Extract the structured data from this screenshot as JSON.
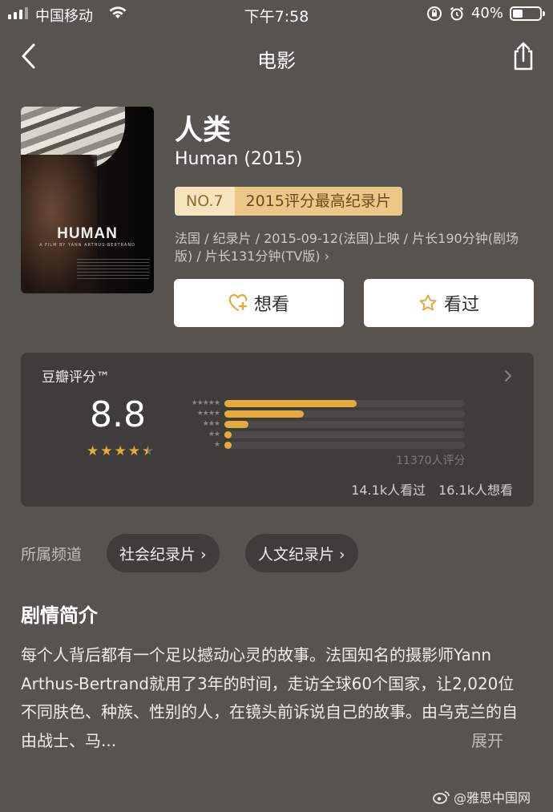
{
  "status_bar": {
    "carrier": "中国移动",
    "time": "下午7:58",
    "battery_percent": "40%",
    "battery_level": 0.4
  },
  "nav": {
    "title": "电影",
    "back_icon": "chevron-left-icon",
    "share_icon": "share-icon"
  },
  "movie": {
    "poster_title": "HUMAN",
    "poster_subtitle": "A FILM BY YANN ARTHUS-BERTRAND",
    "title_cn": "人类",
    "title_en": "Human (2015)",
    "rank_no": "NO.7",
    "rank_text": "2015评分最高纪录片",
    "meta": "法国 / 纪录片 / 2015-09-12(法国)上映 / 片长190分钟(剧场版) / 片长131分钟(TV版) ›"
  },
  "actions": {
    "want_label": "想看",
    "seen_label": "看过"
  },
  "rating": {
    "title": "豆瓣评分™",
    "score": "8.8",
    "stars_filled": 4.5,
    "distribution": [
      {
        "label": "★★★★★",
        "fraction": 0.55
      },
      {
        "label": "★★★★",
        "fraction": 0.33
      },
      {
        "label": "★★★",
        "fraction": 0.1
      },
      {
        "label": "★★",
        "fraction": 0.03
      },
      {
        "label": "★",
        "fraction": 0.03
      }
    ],
    "count_text": "11370人评分",
    "seen_text": "14.1k人看过",
    "want_text": "16.1k人想看"
  },
  "channels": {
    "label": "所属频道",
    "items": [
      {
        "label": "社会纪录片 ›"
      },
      {
        "label": "人文纪录片 ›"
      }
    ]
  },
  "synopsis": {
    "title": "剧情简介",
    "text": "每个人背后都有一个足以撼动心灵的故事。法国知名的摄影师Yann Arthus-Bertrand就用了3年的时间，走访全球60个国家，让2,020位不同肤色、种族、性别的人，在镜头前诉说自己的故事。由乌克兰的自由战士、马...",
    "more_label": "展开"
  },
  "watermark": "@雅思中国网",
  "colors": {
    "background": "#575450",
    "card": "#3f3d3a",
    "accent": "#e6a93c",
    "rank_light": "#f7e4bf",
    "rank_dark": "#ebc887"
  }
}
